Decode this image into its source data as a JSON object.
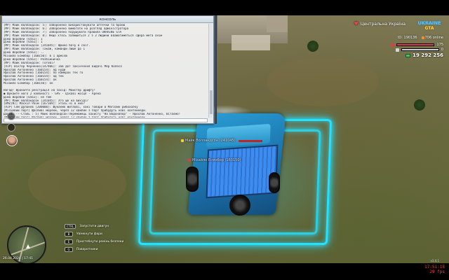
{
  "console": {
    "title": "консоль",
    "lines": [
      "[MP] Майк Волландсон: 5ⓘ заборонено використовувати аптечки та броню",
      "[MP] Майк Волландсон: 6ⓘ Заборонено вимагати на розгляд адміністратора",
      "[MP] Майк Волландсон: 7ⓘ Заборонено порушувати правила UKRAINE GTA",
      "[MP] Майк Волландсон: 8ⓘ Якщо хтось залишиться 2 з 3 людини вважатиметься сфера мега онім",
      "Діма Воробей [6561]: 1",
      "Діма Воробей [6561]: 1",
      "[MP] Майк Волландсон [241045]: Щойно бачу в світ.",
      "[MP] Майк Волландсон: Також, команди лише до 1",
      "Діма Воробей [6561]: ..",
      "Міхайло Есмобор [160150]: в 1 армією",
      "Діма Воробей [6561]: Розбійничка",
      "[MP] Майк Волландсон: Готові?",
      "[VIP] Віктор Черненко[147406]: Зав дот закінчення видачі Мер Колесо",
      "Ярослав Антоненко [160154]: нд нуди",
      "Ярослав Антоненко [160154]: по камерах тек го",
      "Ярослав Антоненко [160154]: нд тек",
      "Ярослав Антоненко [160154]: ок",
      "Міхайло Есмобор [160150]: ок",
      "",
      "Нагад! Вракалта реєстрація на захід: Майстер дрифту!",
      "● Шукайте його 2 наявності - GPS - Цікаві місця - Арена",
      "Діма Воробей [6561]: не тем",
      "[MP] Майк Волландсон [241045]: Хто ще на вихіді?",
      "[DMZ(N)] Маскіп Раїм [167109]: хтось ні в них?",
      "[VIP] Сем Дулакев [200000]: Шукаємо житлові, хакі товари в Магазин рибохолку",
      "[Місцевий порт] Щасливі моряки, через 12 хвилин з порт прибудуть нові контейнери.",
      "Дарів: ···Сталь : 5] Майк Волландсон Переможець захисту \"На Водонапор\" - Ярослав Антоненко, Вітаємо!",
      "[Морський порт] Шасливі моряки, через 13 хвилин з порт прибудуть нові контейнери.",
      "Дарів: ··Сталь : 5] Майк Волландсон Парадок прамія! БАКАН(V) Манмечу Барахко, Максар Район, Томату Сатол, Сан Бульту, Полю Прайм, Фалкон,",
      "Дарів: ··Сталь : 5] Майк Волландсон Такон Мисон, Ордени, Панлеус, Глобайту, Есмобарко."
    ]
  },
  "hud": {
    "region": "Центральна Україна",
    "logo_line1": "UKRAINE",
    "logo_line2": "GTA",
    "id_text": "ID: 190136",
    "online_text": "706 online",
    "health": "175",
    "armor": "0",
    "money": "19 292 256",
    "colors": {
      "health": "#e93a3a",
      "armor": "#d6d6d6",
      "money": "#49c35a",
      "neon": "#26e1ff"
    }
  },
  "nametags": [
    {
      "name": "Майк Волландсон (241045)"
    },
    {
      "name": "Міхайло Есмобор (160150)"
    }
  ],
  "hints": [
    {
      "key": "CTRL",
      "label": "Запустити двигун"
    },
    {
      "key": "B",
      "label": "Увімкнути фари"
    },
    {
      "key": "E",
      "label": "Пристебнути ремінь безпеки"
    },
    {
      "key": "G",
      "label": "Поворотники"
    }
  ],
  "minimap": {
    "date": "26.04.2024 | 17:41"
  },
  "bottom": {
    "version": "v3.4.1",
    "time": "17:51:18",
    "fps": "29 fps"
  }
}
